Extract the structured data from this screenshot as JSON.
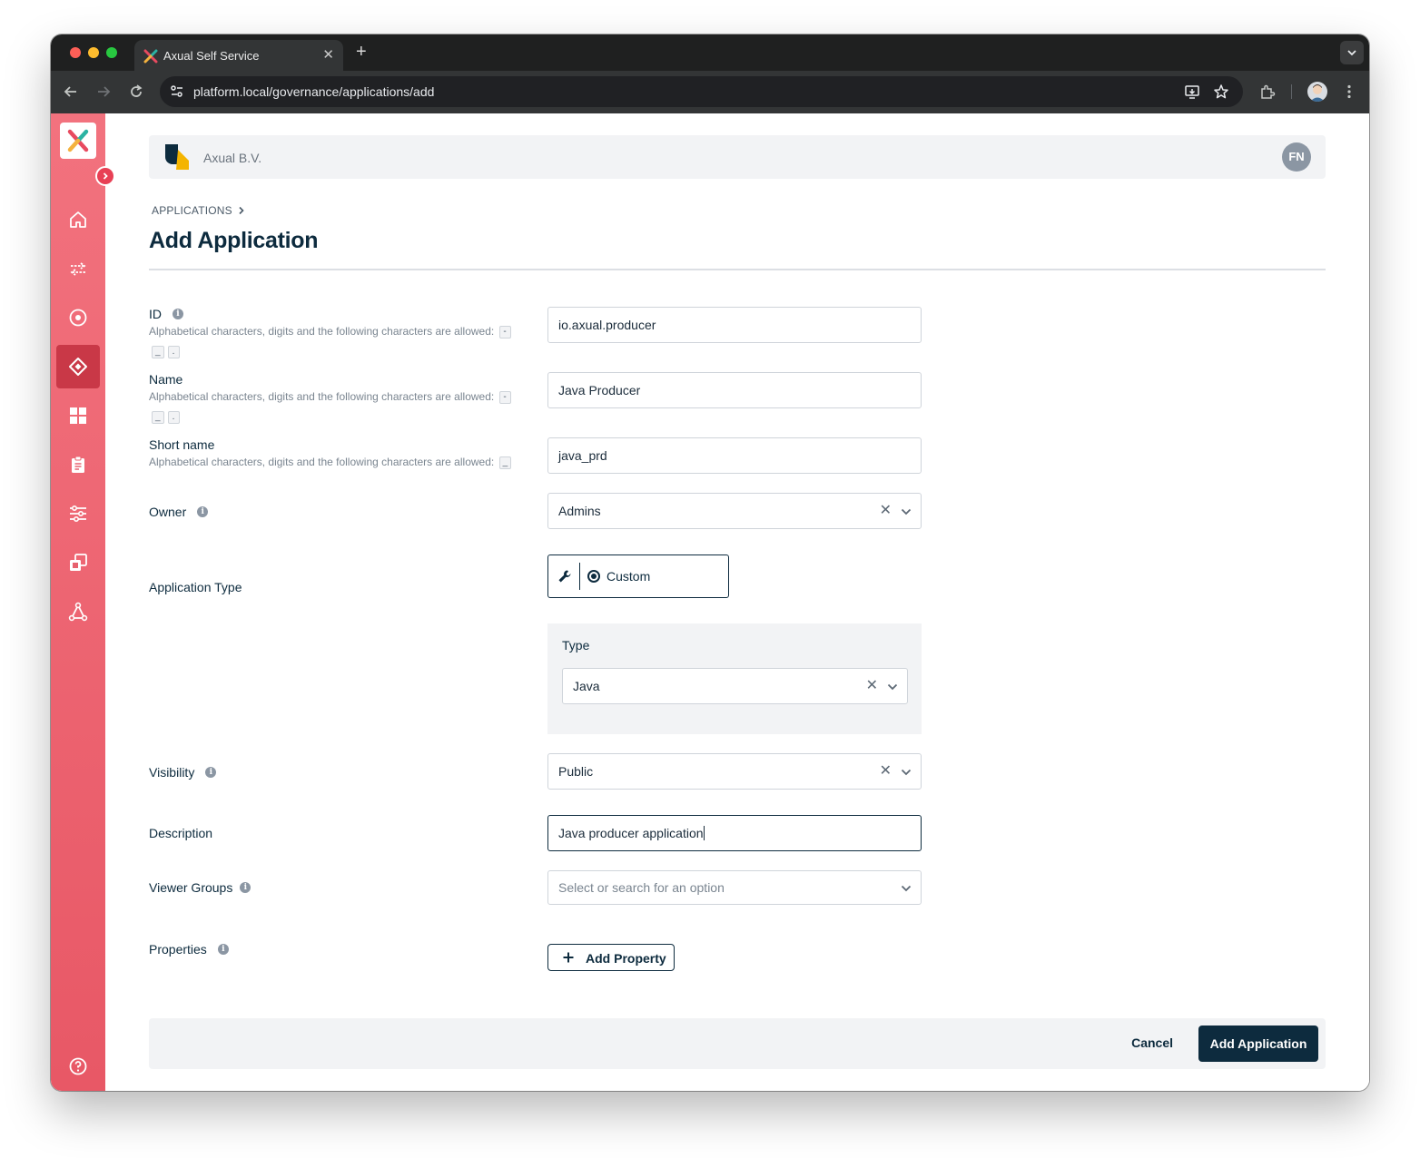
{
  "browser": {
    "tab_title": "Axual Self Service",
    "tab_close": "✕",
    "new_tab": "+",
    "url": "platform.local/governance/applications/add"
  },
  "org": {
    "name": "Axual B.V.",
    "user_initials": "FN"
  },
  "breadcrumb": {
    "root": "APPLICATIONS"
  },
  "page": {
    "title": "Add Application"
  },
  "form": {
    "id": {
      "label": "ID",
      "hint": "Alphabetical characters, digits and the following characters are allowed:",
      "chips": [
        "-",
        "_",
        "."
      ],
      "value": "io.axual.producer"
    },
    "name": {
      "label": "Name",
      "hint": "Alphabetical characters, digits and the following characters are allowed:",
      "chips": [
        "-",
        "_",
        "."
      ],
      "value": "Java Producer"
    },
    "short_name": {
      "label": "Short name",
      "hint": "Alphabetical characters, digits and the following characters are allowed:",
      "chips": [
        "_"
      ],
      "value": "java_prd"
    },
    "owner": {
      "label": "Owner",
      "value": "Admins"
    },
    "application_type": {
      "label": "Application Type",
      "option": "Custom",
      "type_label": "Type",
      "type_value": "Java"
    },
    "visibility": {
      "label": "Visibility",
      "value": "Public"
    },
    "description": {
      "label": "Description",
      "value": "Java producer application"
    },
    "viewer_groups": {
      "label": "Viewer Groups",
      "placeholder": "Select or search for an option"
    },
    "properties": {
      "label": "Properties",
      "add_button": "Add Property"
    }
  },
  "footer": {
    "cancel": "Cancel",
    "submit": "Add Application"
  },
  "icons": {
    "clear": "✕",
    "info": "i",
    "sidebar": [
      "home-icon",
      "streams-icon",
      "target-icon",
      "applications-icon",
      "dashboard-icon",
      "clipboard-icon",
      "settings-sliders-icon",
      "copy-icon",
      "network-icon",
      "help-icon"
    ]
  },
  "colors": {
    "sidebar_top": "#f2727e",
    "sidebar_bottom": "#e85866",
    "sidebar_active": "#c93847",
    "primary": "#0d2b3e",
    "panel_bg": "#f2f3f5"
  }
}
